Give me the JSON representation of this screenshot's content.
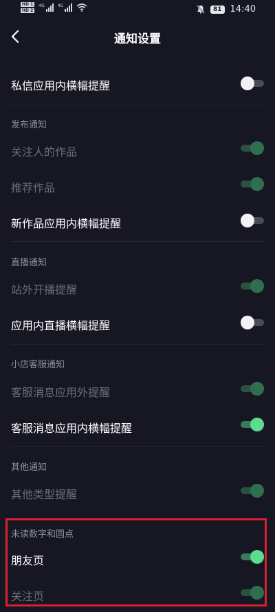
{
  "status_bar": {
    "hd1": "HD 1",
    "hd2": "HD 2",
    "net1": "4G",
    "net2": "4G",
    "battery": "81",
    "time": "14:40"
  },
  "header": {
    "title": "通知设置"
  },
  "settings": [
    {
      "label": "私信应用内横幅提醒",
      "state": "off"
    },
    {
      "label": "关注人的作品",
      "state": "on-dim"
    },
    {
      "label": "推荐作品",
      "state": "on-dim"
    },
    {
      "label": "新作品应用内横幅提醒",
      "state": "off"
    },
    {
      "label": "站外开播提醒",
      "state": "on-dim"
    },
    {
      "label": "应用内直播横幅提醒",
      "state": "off"
    },
    {
      "label": "客服消息应用外提醒",
      "state": "on-dim"
    },
    {
      "label": "客服消息应用内横幅提醒",
      "state": "on"
    },
    {
      "label": "其他类型提醒",
      "state": "on-dim"
    },
    {
      "label": "朋友页",
      "state": "on"
    },
    {
      "label": "关注页",
      "state": "on-dim"
    }
  ],
  "sections": {
    "publish": "发布通知",
    "live": "直播通知",
    "shop": "小店客服通知",
    "other": "其他通知",
    "unread": "未读数字和圆点"
  },
  "colors": {
    "background": "#161723",
    "toggle_on": "#5bdc8f",
    "highlight": "#d8202e"
  }
}
